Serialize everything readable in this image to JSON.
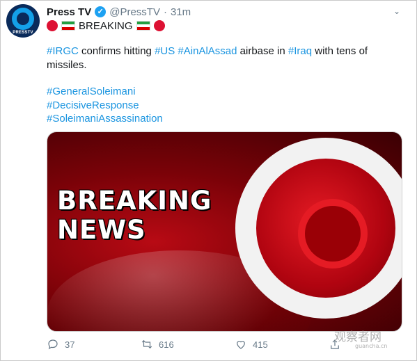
{
  "account": {
    "name": "Press TV",
    "handle": "@PressTV",
    "separator": "·",
    "time": "31m",
    "avatar_brand": "PRESSTV"
  },
  "tweet": {
    "breaking_label": "BREAKING",
    "body": {
      "tag_irgc": "#IRGC",
      "text1": " confirms hitting ",
      "tag_us": "#US",
      "text2": " ",
      "tag_ainalassad": "#AinAlAssad",
      "text3": " airbase in ",
      "tag_iraq": "#Iraq",
      "text4": " with tens of missiles."
    },
    "hashtags": [
      "#GeneralSoleimani",
      "#DecisiveResponse",
      "#SoleimaniAssassination"
    ]
  },
  "media": {
    "headline_line1": "BREAKING",
    "headline_line2": "NEWS"
  },
  "actions": {
    "replies": "37",
    "retweets": "616",
    "likes": "415"
  },
  "watermark": {
    "main": "观察者网",
    "sub": "guancha.cn"
  },
  "colors": {
    "link": "#1b95e0",
    "verified": "#1da1f2",
    "muted": "#657786",
    "breaking_red": "#dd1133"
  },
  "icons": [
    "verified-badge-icon",
    "chevron-down-icon",
    "red-circle-icon",
    "iran-flag-icon",
    "reply-icon",
    "retweet-icon",
    "like-icon",
    "share-icon"
  ]
}
